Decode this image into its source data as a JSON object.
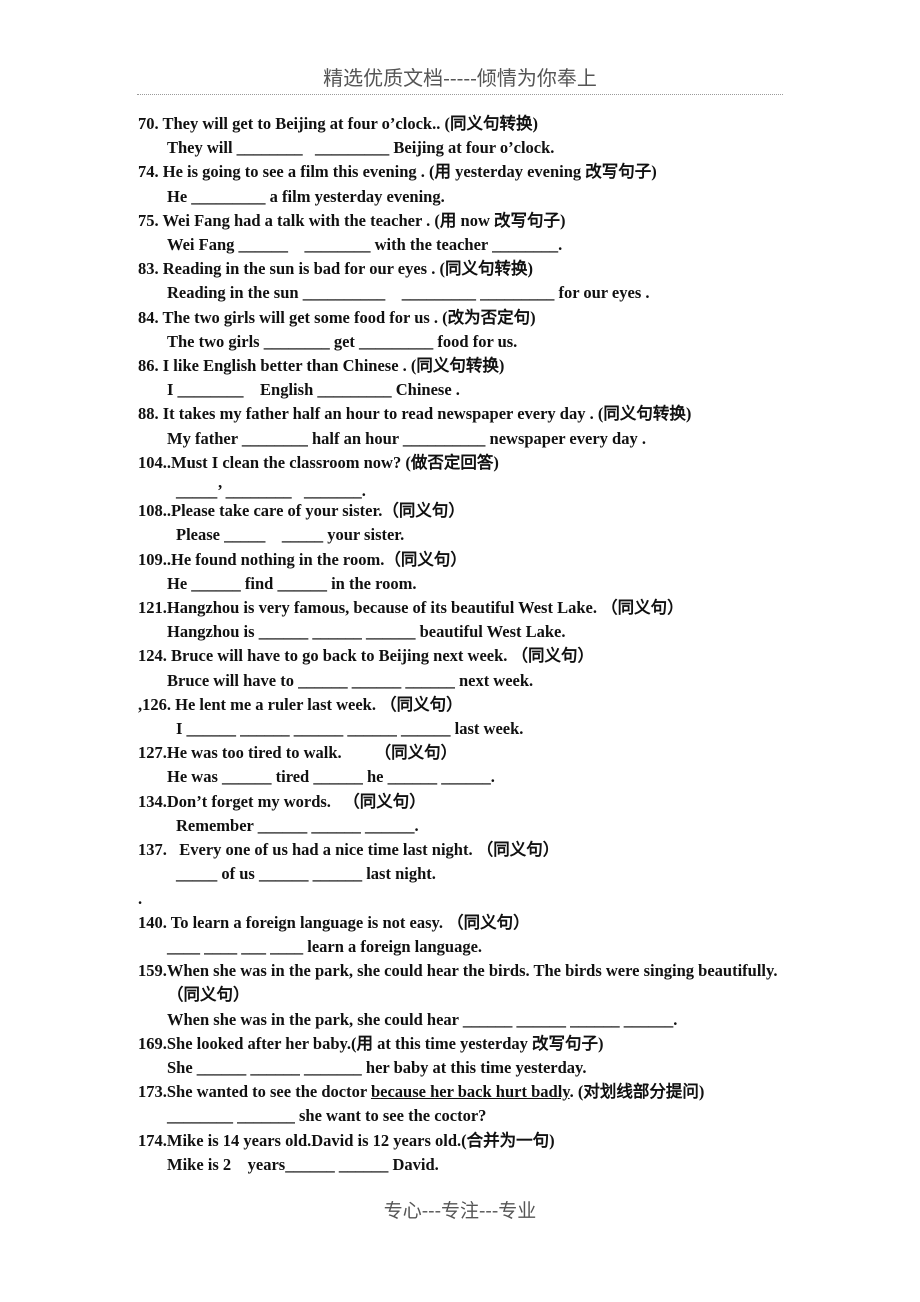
{
  "header": "精选优质文档-----倾情为你奉上",
  "footer": "专心---专注---专业",
  "exercises": [
    {
      "q": "70. They will get to Beijing at four o’clock.. (同义句转换)",
      "a": "They will ________   _________ Beijing at four o’clock."
    },
    {
      "q": "74. He is going to see a film this evening . (用 yesterday evening 改写句子)",
      "a": "He _________ a film yesterday evening."
    },
    {
      "q": "75. Wei Fang had a talk with the teacher . (用 now 改写句子)",
      "a": "Wei Fang ______    ________ with the teacher ________."
    },
    {
      "q": "83. Reading in the sun is bad for our eyes . (同义句转换)",
      "a": "Reading in the sun __________    _________ _________ for our eyes ."
    },
    {
      "q": "84. The two girls will get some food for us . (改为否定句)",
      "a": "The two girls ________ get _________ food for us."
    },
    {
      "q": "86. I like English better than Chinese . (同义句转换)",
      "a": "I ________    English _________ Chinese ."
    },
    {
      "q": "88. It takes my father half an hour to read newspaper every day . (同义句转换)",
      "a": "My father ________ half an hour __________ newspaper every day ."
    },
    {
      "q": "104..Must I clean the classroom now? (做否定回答)",
      "a": "",
      "a2": "_____’ ________   _______."
    },
    {
      "q": "108..Please take care of your sister.（同义句）",
      "a2": "Please _____    _____ your sister."
    },
    {
      "q": "109..He found nothing in the room.（同义句）",
      "a": "He ______ find ______ in the room."
    },
    {
      "q": "121.Hangzhou is very famous, because of its beautiful West Lake. （同义句）",
      "a": "Hangzhou is ______ ______ ______ beautiful West Lake."
    },
    {
      "q": "124. Bruce will have to go back to Beijing next week. （同义句）",
      "a": "Bruce will have to ______ ______ ______ next week."
    },
    {
      "q": ",126. He lent me a ruler last week. （同义句）",
      "a2": "I ______ ______ ______ ______ ______ last week."
    },
    {
      "q": "127.He was too tired to walk.        （同义句）",
      "a": "He was ______ tired ______ he ______ ______."
    },
    {
      "q": "134.Don’t forget my words.   （同义句）",
      "a2": "Remember ______ ______ ______."
    },
    {
      "q": "137.   Every one of us had a nice time last night. （同义句）",
      "a2": "_____ of us ______ ______ last night."
    },
    {
      "dot": "."
    },
    {
      "q": "140. To learn a foreign language is not easy. （同义句）",
      "a": "____ ____ ___ ____ learn a foreign language."
    },
    {
      "q": "159.When she was in the park, she could hear the birds. The birds were singing beautifully. （同义句）",
      "a": "When she was in the park, she could hear ______ ______ ______ ______."
    },
    {
      "q": "169.She looked after her baby.(用 at this time yesterday 改写句子)",
      "a": "She ______ ______ _______ her baby at this time yesterday."
    },
    {
      "q173_pre": "173.She wanted to see the doctor ",
      "q173_u": "because her back hurt badly",
      "q173_post": ". (对划线部分提问)",
      "a": "________ _______ she want to see the coctor?"
    },
    {
      "q": "174.Mike is 14 years old.David is 12 years old.(合并为一句)",
      "a": "Mike is 2    years______ ______ David."
    }
  ]
}
